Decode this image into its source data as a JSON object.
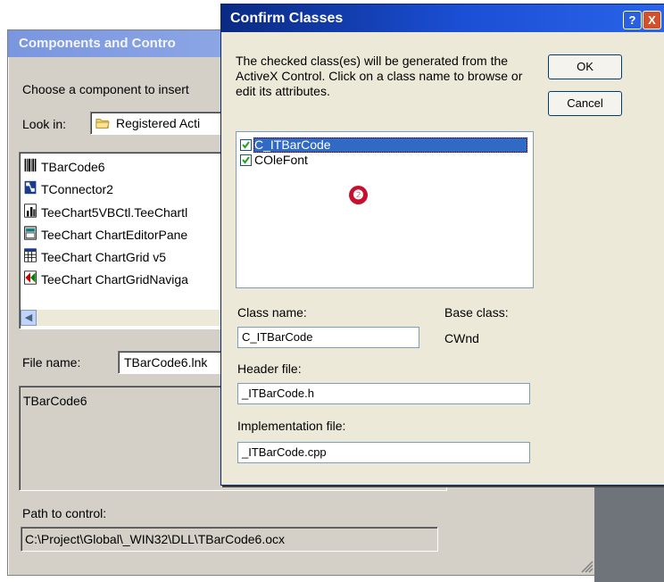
{
  "background_dialog": {
    "title": "Components and Contro",
    "instruction": "Choose a component to insert",
    "look_in_label": "Look in:",
    "look_in_value": "Registered Acti",
    "components": [
      {
        "label": "TBarCode6",
        "icon": "barcode-icon"
      },
      {
        "label": "TConnector2",
        "icon": "connector-icon"
      },
      {
        "label": "TeeChart5VBCtl.TeeChartl",
        "icon": "chart-icon"
      },
      {
        "label": "TeeChart ChartEditorPane",
        "icon": "editor-icon"
      },
      {
        "label": "TeeChart ChartGrid v5",
        "icon": "grid-icon"
      },
      {
        "label": "TeeChart ChartGridNaviga",
        "icon": "grid-nav-icon"
      }
    ],
    "file_name_label": "File name:",
    "file_name_value": "TBarCode6.lnk",
    "description": "TBarCode6",
    "path_label": "Path to control:",
    "path_value": "C:\\Project\\Global\\_WIN32\\DLL\\TBarCode6.ocx"
  },
  "confirm_dialog": {
    "title": "Confirm Classes",
    "help_button": "?",
    "close_button": "X",
    "description": "The checked class(es) will be generated from the ActiveX Control.  Click on a class name to browse or edit its attributes.",
    "ok_label": "OK",
    "cancel_label": "Cancel",
    "classes": [
      {
        "name": "C_ITBarCode",
        "checked": true,
        "selected": true
      },
      {
        "name": "COleFont",
        "checked": true,
        "selected": false
      }
    ],
    "marker": "❷",
    "class_name_label": "Class name:",
    "class_name_value": "C_ITBarCode",
    "base_class_label": "Base class:",
    "base_class_value": "CWnd",
    "header_file_label": "Header file:",
    "header_file_value": "_ITBarCode.h",
    "impl_file_label": "Implementation file:",
    "impl_file_value": "_ITBarCode.cpp"
  },
  "colors": {
    "title_active": "#0a246a",
    "title_inactive": "#7a96df",
    "selection": "#316ac5",
    "marker": "#c8102e"
  }
}
